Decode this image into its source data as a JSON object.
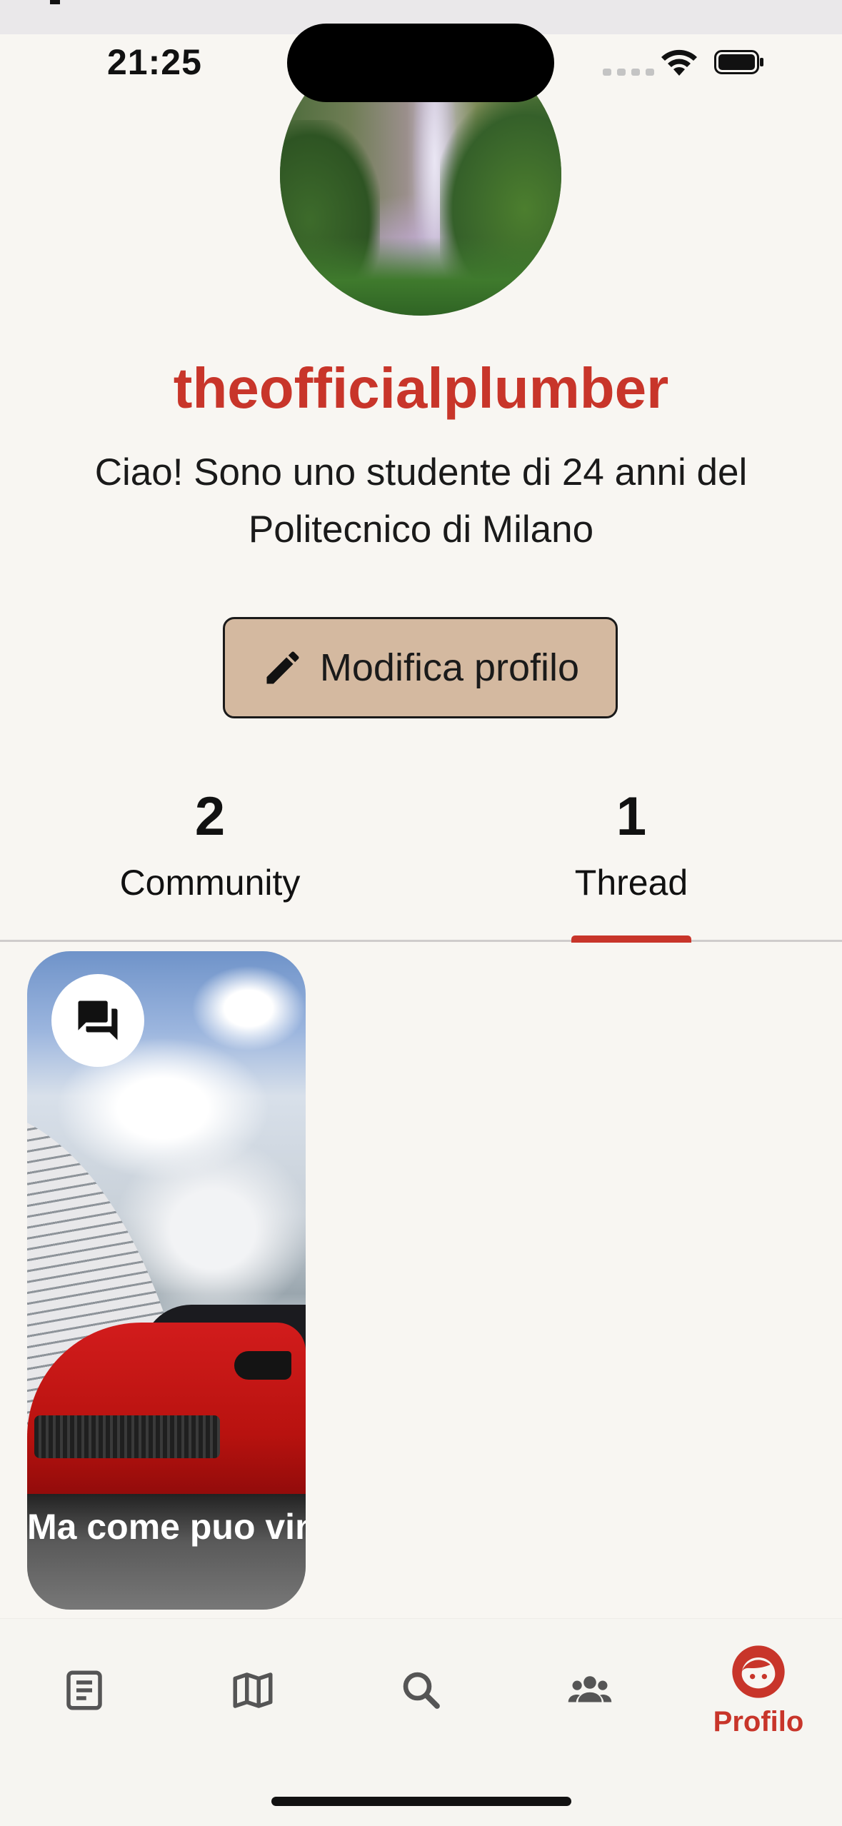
{
  "status": {
    "time": "21:25"
  },
  "profile": {
    "username": "theofficialplumber",
    "bio": "Ciao! Sono uno studente di 24 anni del Politecnico di Milano",
    "edit_button": "Modifica profilo"
  },
  "stats": [
    {
      "count": "2",
      "label": "Community"
    },
    {
      "count": "1",
      "label": "Thread"
    }
  ],
  "selected_tab": "Thread",
  "thread_card": {
    "icon": "forum-icon",
    "caption": "Ma come puo vincere la Me.."
  },
  "tabbar": {
    "items": [
      {
        "icon": "feed-icon",
        "label": ""
      },
      {
        "icon": "map-icon",
        "label": ""
      },
      {
        "icon": "search-icon",
        "label": ""
      },
      {
        "icon": "community-icon",
        "label": ""
      },
      {
        "icon": "profile-icon",
        "label": "Profilo"
      }
    ],
    "active_index": 4
  },
  "colors": {
    "accent": "#c8352a",
    "button_bg": "#d4b9a0",
    "background": "#f8f6f2"
  }
}
